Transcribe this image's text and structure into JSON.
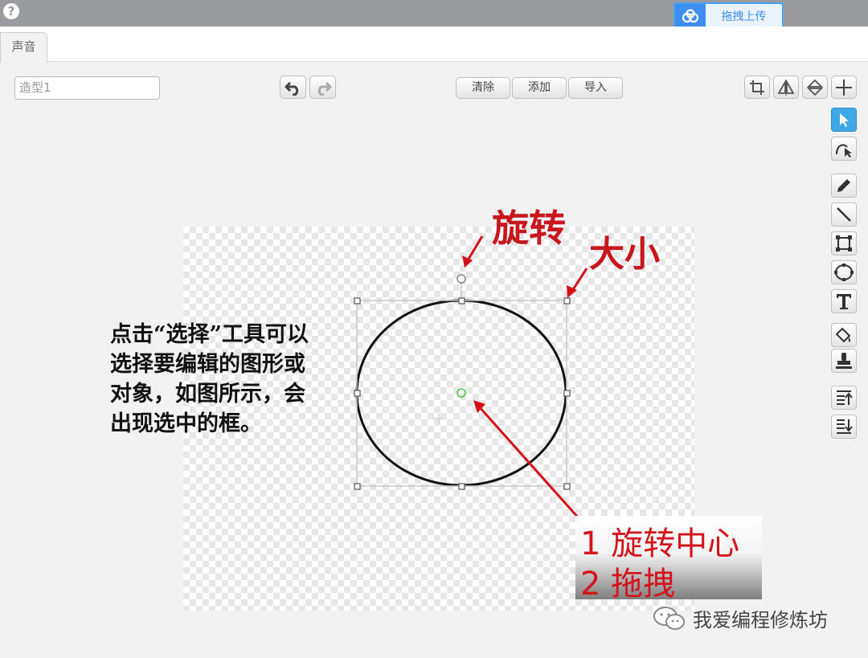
{
  "topbar": {
    "upload_label": "拖拽上传"
  },
  "tabs": [
    {
      "label": "声音"
    }
  ],
  "editor": {
    "costume_name": "造型1",
    "clear_label": "清除",
    "add_label": "添加",
    "import_label": "导入"
  },
  "annotations": {
    "rotate": "旋转",
    "size": "大小",
    "description": "点击“选择”工具可以选择要编辑的图形或对象，如图所示，会出现选中的框。",
    "note_line1": "1 旋转中心",
    "note_line2": "2 拖拽"
  },
  "watermark": {
    "text": "我爱编程修炼坊"
  },
  "colors": {
    "annotation_red": "#c8161d",
    "active_tool": "#3ea9e6",
    "upload_blue": "#3d8ef0"
  },
  "tools": [
    "select-icon",
    "reshape-icon",
    "pencil-icon",
    "line-icon",
    "rectangle-icon",
    "ellipse-icon",
    "text-icon",
    "fill-icon",
    "stamp-icon",
    "bring-forward-icon",
    "send-backward-icon"
  ]
}
